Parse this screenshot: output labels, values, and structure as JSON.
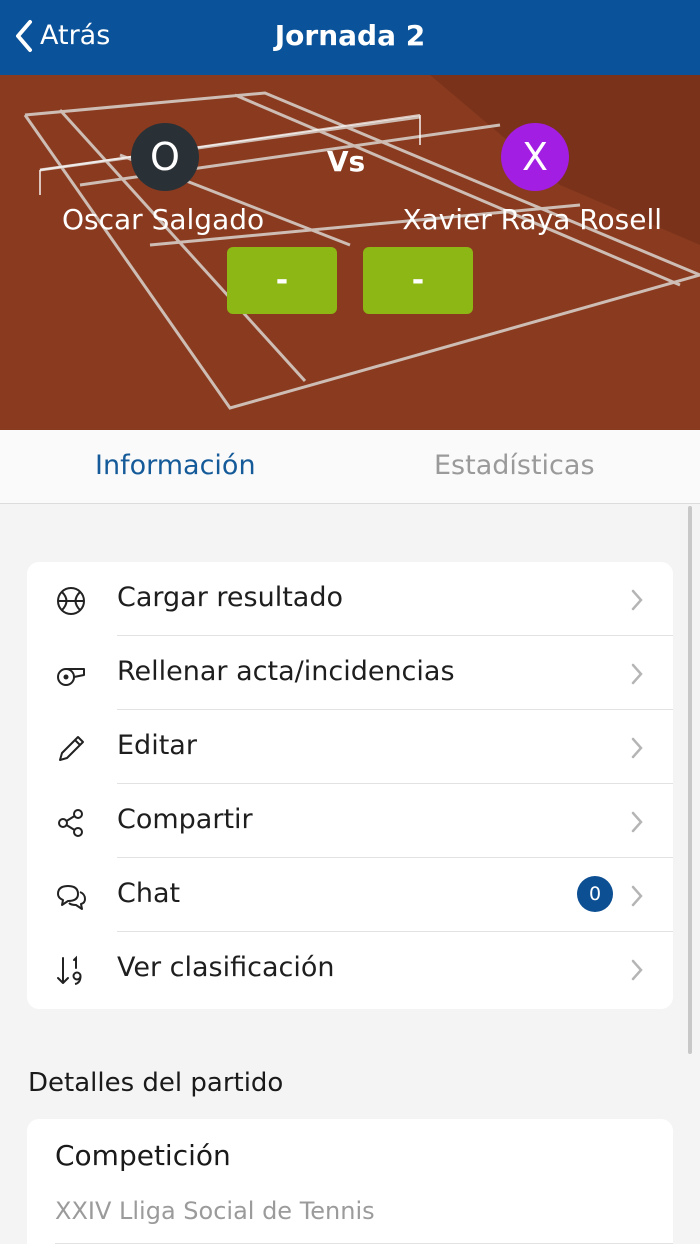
{
  "header": {
    "back_label": "Atrás",
    "title": "Jornada 2"
  },
  "match": {
    "player1": {
      "initial": "O",
      "name": "Oscar Salgado",
      "color": "#2a3136",
      "score": "-"
    },
    "player2": {
      "initial": "X",
      "name": "Xavier Raya Rosell",
      "color": "#a21ee3",
      "score": "-"
    },
    "vs_label": "Vs"
  },
  "tabs": [
    {
      "label": "Información",
      "active": true
    },
    {
      "label": "Estadísticas",
      "active": false
    }
  ],
  "menu": [
    {
      "label": "Cargar resultado",
      "icon": "tennis-ball-icon"
    },
    {
      "label": "Rellenar acta/incidencias",
      "icon": "whistle-icon"
    },
    {
      "label": "Editar",
      "icon": "pencil-icon"
    },
    {
      "label": "Compartir",
      "icon": "share-icon"
    },
    {
      "label": "Chat",
      "icon": "chat-icon",
      "badge": "0"
    },
    {
      "label": "Ver clasificación",
      "icon": "sort-ranking-icon"
    }
  ],
  "details": {
    "section_title": "Detalles del partido",
    "competition_label": "Competición",
    "competition_value": "XXIV Lliga Social de Tennis"
  },
  "colors": {
    "header": "#0a5299",
    "score": "#8cb714",
    "tab_active": "#155a99",
    "badge": "#0d4f93"
  }
}
